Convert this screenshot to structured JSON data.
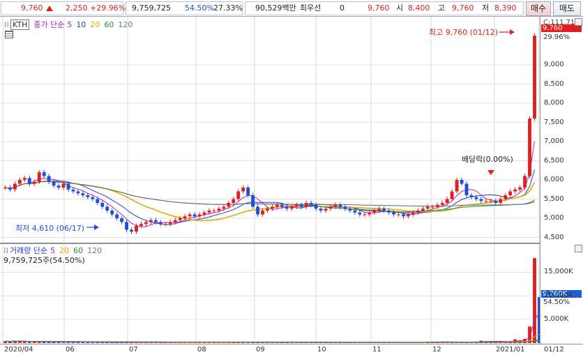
{
  "topbar": {
    "price": "9,760",
    "change": "2,250",
    "change_pct": "+29.96%",
    "volume": "9,759,725",
    "vol_ratio": "54.50%",
    "turnover": "27.33%",
    "trade_value": "90,529백만",
    "priority_label": "최우선",
    "priority_qty": "0",
    "priority_price": "9,760",
    "open_label": "시",
    "open": "8,400",
    "high_label": "고",
    "high": "9,760",
    "low_label": "저",
    "low": "8,390",
    "buy_label": "매수",
    "sell_label": "매도"
  },
  "price_panel": {
    "ticker": "KTH",
    "legend_main": "종가 단순",
    "ma_periods": [
      "5",
      "10",
      "20",
      "60",
      "120"
    ],
    "ma_colors": [
      "#b023b0",
      "#1f3fd0",
      "#e6a800",
      "#1c9a3a",
      "#666666"
    ],
    "high_annotation": "최고 9,760 (01/12)",
    "low_annotation": "최저 4,610 (06/17)",
    "dividend_annotation": "배당락(0.00%)",
    "current_price_tag": "9,760",
    "current_pct": "29.96%",
    "top_value": "C:111.71"
  },
  "volume_panel": {
    "legend_main": "거래량 단순",
    "ma_periods": [
      "5",
      "20",
      "60",
      "120"
    ],
    "ma_colors": [
      "#b023b0",
      "#e6a800",
      "#1c9a3a",
      "#666666"
    ],
    "info": "9,759,725주(54.50%)",
    "current_tag": "9,760K",
    "current_pct": "54.50%"
  },
  "price_axis": [
    "9,000",
    "8,500",
    "8,000",
    "7,500",
    "7,000",
    "6,500",
    "6,000",
    "5,500",
    "5,000",
    "4,500"
  ],
  "volume_axis": [
    "15,000K",
    "10,000K",
    "5,000K"
  ],
  "date_axis": [
    "2020/04",
    "06",
    "07",
    "08",
    "09",
    "10",
    "11",
    "12",
    "2021/01",
    "01/12"
  ],
  "chart_data": {
    "type": "candlestick",
    "ylim": [
      4400,
      10000
    ],
    "volume_ylim": [
      0,
      19500
    ],
    "price_close_series": [
      5800,
      5750,
      5900,
      6000,
      6050,
      5900,
      5950,
      6200,
      6100,
      5950,
      5850,
      5800,
      5900,
      5750,
      5700,
      5650,
      5600,
      5550,
      5500,
      5400,
      5300,
      5200,
      5100,
      5000,
      4900,
      4700,
      4650,
      4800,
      4850,
      4900,
      4950,
      4900,
      4850,
      4850,
      4900,
      4950,
      5000,
      5050,
      5100,
      5050,
      5100,
      5150,
      5200,
      5200,
      5250,
      5300,
      5400,
      5500,
      5700,
      5800,
      5600,
      5300,
      5100,
      5200,
      5250,
      5300,
      5350,
      5300,
      5250,
      5300,
      5350,
      5300,
      5400,
      5350,
      5250,
      5200,
      5250,
      5300,
      5350,
      5300,
      5250,
      5200,
      5150,
      5100,
      5100,
      5150,
      5200,
      5250,
      5200,
      5150,
      5100,
      5100,
      5050,
      5100,
      5150,
      5200,
      5250,
      5300,
      5300,
      5350,
      5400,
      5500,
      5700,
      6000,
      5900,
      5600,
      5550,
      5500,
      5450,
      5450,
      5450,
      5400,
      5500,
      5600,
      5700,
      5750,
      5800,
      6100,
      7600,
      9760
    ],
    "volume_series": [
      400,
      350,
      500,
      380,
      300,
      250,
      350,
      300,
      280,
      260,
      250,
      240,
      230,
      220,
      300,
      260,
      220,
      200,
      180,
      170,
      160,
      150,
      150,
      140,
      200,
      160,
      150,
      140,
      130,
      150,
      160,
      140,
      130,
      120,
      140,
      150,
      160,
      170,
      180,
      170,
      300,
      250,
      200,
      180,
      170,
      160,
      180,
      200,
      230,
      200,
      190,
      180,
      170,
      160,
      150,
      160,
      170,
      180,
      160,
      150,
      140,
      130,
      150,
      140,
      130,
      120,
      130,
      140,
      150,
      140,
      130,
      120,
      110,
      100,
      110,
      120,
      130,
      140,
      130,
      120,
      110,
      100,
      110,
      120,
      130,
      140,
      150,
      300,
      280,
      250,
      220,
      200,
      180,
      170,
      160,
      150,
      200,
      300,
      500,
      400,
      350,
      300,
      280,
      260,
      400,
      800,
      600,
      900,
      3500,
      18000,
      9760
    ]
  }
}
